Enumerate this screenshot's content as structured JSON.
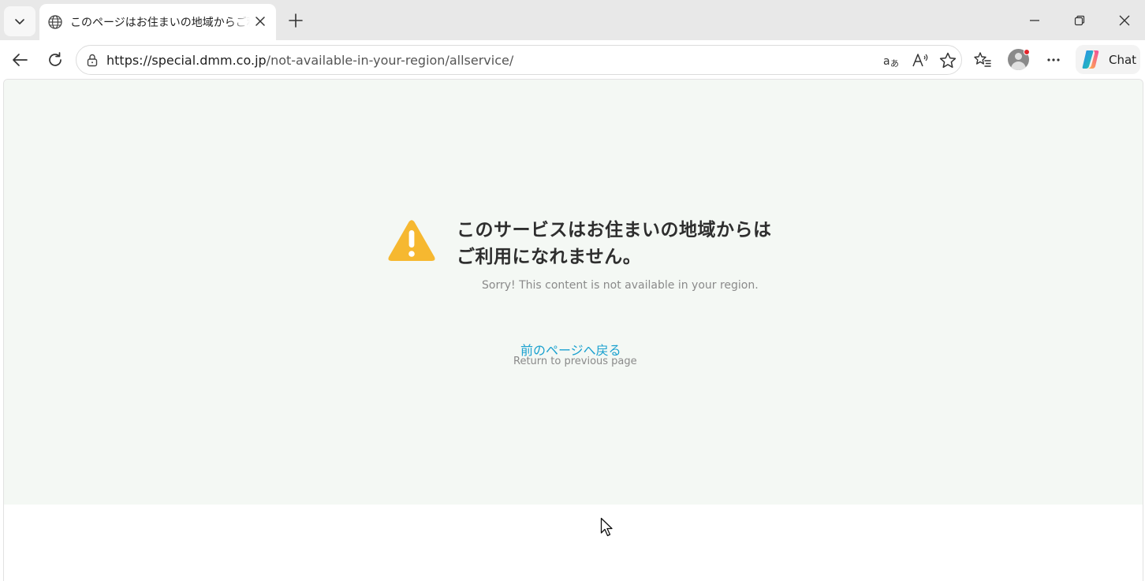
{
  "browser": {
    "tab": {
      "title": "このページはお住まいの地域からご利用になれません",
      "favicon": "globe-icon"
    },
    "address_bar": {
      "url_host": "https://special.dmm.co.jp",
      "url_path": "/not-available-in-your-region/allservice/"
    },
    "toolbar": {
      "chat_label": "Chat"
    },
    "icons": [
      "chevron-down-icon",
      "globe-icon",
      "close-icon",
      "plus-icon",
      "minimize-icon",
      "restore-icon",
      "window-close-icon",
      "back-icon",
      "refresh-icon",
      "lock-icon",
      "translate-icon",
      "read-aloud-icon",
      "star-icon",
      "favorites-icon",
      "profile-avatar",
      "more-icon",
      "copilot-icon"
    ]
  },
  "page": {
    "heading_line1": "このサービスはお住まいの地域からは",
    "heading_line2": "ご利用になれません。",
    "sorry_text": "Sorry! This content is not available in your region.",
    "back_link": "前のページへ戻る",
    "back_sub": "Return to previous page",
    "colors": {
      "background": "#f4f8f4",
      "warning": "#f6b830",
      "link": "#1ba1cf"
    }
  }
}
